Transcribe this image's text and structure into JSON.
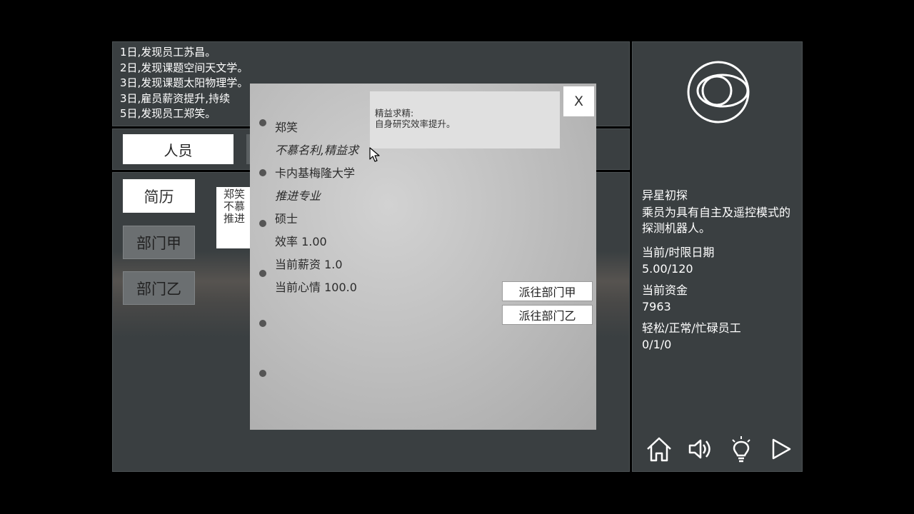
{
  "log": [
    "1日,发现员工苏昌。",
    "2日,发现课题空间天文学。",
    "3日,发现课题太阳物理学。",
    "3日,雇员薪资提升,持续",
    "5日,发现员工郑笑。"
  ],
  "tabs": {
    "personnel": "人员"
  },
  "sidebar": {
    "resume": "简历",
    "dept_a": "部门甲",
    "dept_b": "部门乙"
  },
  "resume_card": {
    "line1": "郑笑",
    "line2": "不慕",
    "line3": "推进"
  },
  "modal": {
    "name": "郑笑",
    "trait": "不慕名利,精益求",
    "school": "卡内基梅隆大学",
    "major": "推进专业",
    "degree": "硕士",
    "efficiency": "效率 1.00",
    "salary": "当前薪资 1.0",
    "mood": "当前心情 100.0",
    "assign_a": "派往部门甲",
    "assign_b": "派往部门乙",
    "close": "X"
  },
  "tooltip": {
    "title": "精益求精:",
    "body": "自身研究效率提升。"
  },
  "info": {
    "mission_name": "异星初探",
    "mission_desc": "乘员为具有自主及遥控模式的探测机器人。",
    "date_label": "当前/时限日期",
    "date_value": "5.00/120",
    "funds_label": "当前资金",
    "funds_value": "7963",
    "staff_label": "轻松/正常/忙碌员工",
    "staff_value": "0/1/0"
  },
  "icons": [
    "home-icon",
    "sound-icon",
    "lightbulb-icon",
    "play-icon"
  ]
}
